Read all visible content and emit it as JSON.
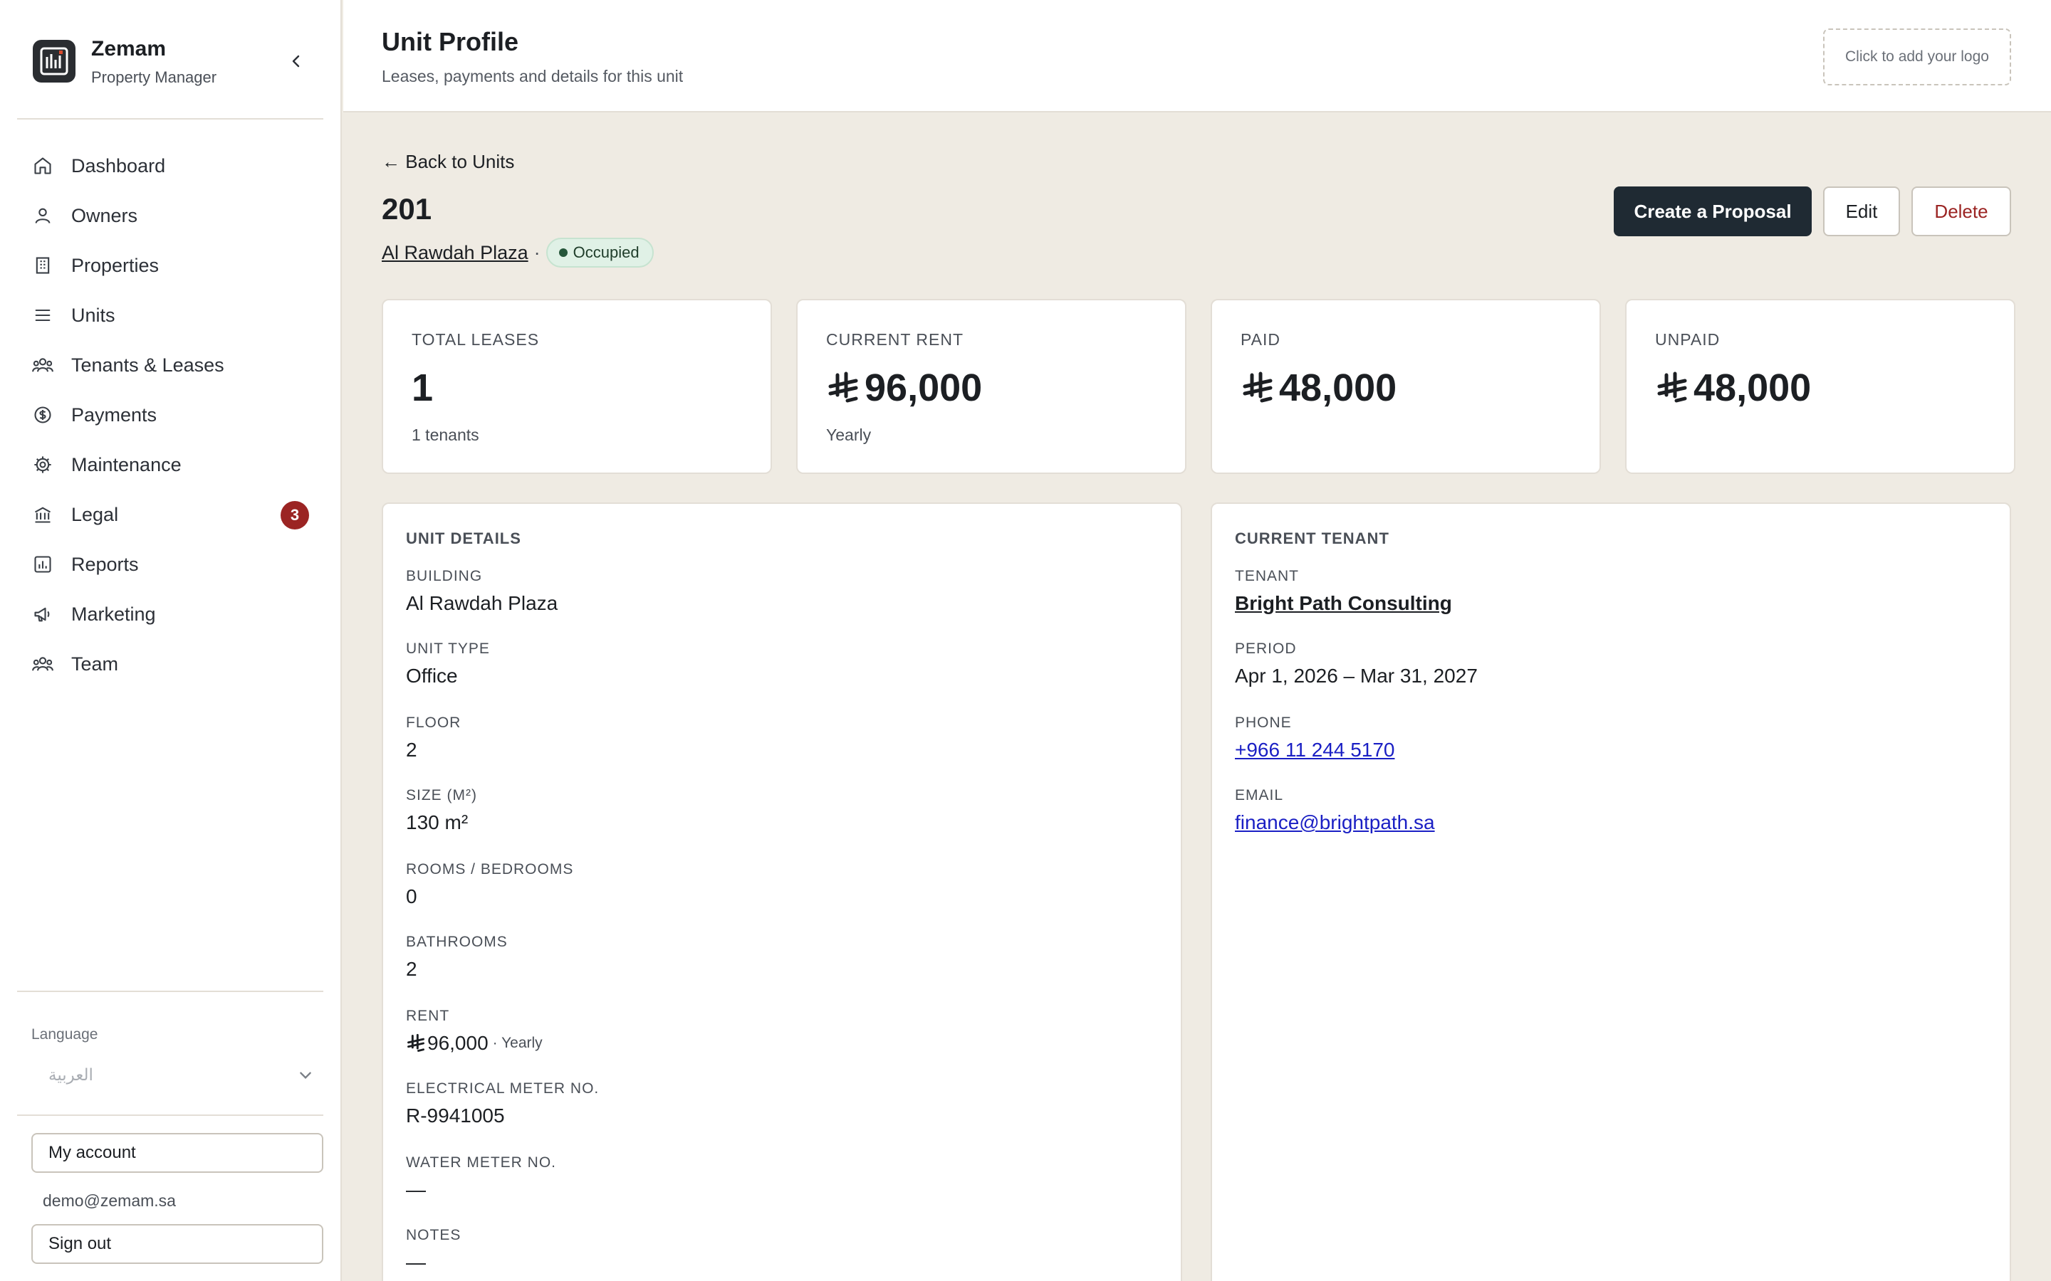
{
  "sidebar": {
    "brand_name": "Zemam",
    "brand_sub": "Property Manager",
    "nav": [
      {
        "label": "Dashboard"
      },
      {
        "label": "Owners"
      },
      {
        "label": "Properties"
      },
      {
        "label": "Units"
      },
      {
        "label": "Tenants & Leases"
      },
      {
        "label": "Payments"
      },
      {
        "label": "Maintenance"
      },
      {
        "label": "Legal",
        "badge": "3"
      },
      {
        "label": "Reports"
      },
      {
        "label": "Marketing"
      },
      {
        "label": "Team"
      }
    ],
    "language_label": "Language",
    "language_value": "العربية",
    "my_account": "My account",
    "email": "demo@zemam.sa",
    "sign_out": "Sign out"
  },
  "header": {
    "title": "Unit Profile",
    "subtitle": "Leases, payments and details for this unit",
    "logo_placeholder": "Click to add your logo"
  },
  "unit": {
    "back": "← Back to Units",
    "number": "201",
    "building": "Al Rawdah Plaza",
    "separator": "·",
    "status": "Occupied"
  },
  "actions": {
    "create": "Create a Proposal",
    "edit": "Edit",
    "delete": "Delete"
  },
  "stats": [
    {
      "label": "TOTAL LEASES",
      "value": "1",
      "foot": "1 tenants"
    },
    {
      "label": "CURRENT RENT",
      "value": "96,000",
      "foot": "Yearly"
    },
    {
      "label": "PAID",
      "value": "48,000",
      "foot": ""
    },
    {
      "label": "UNPAID",
      "value": "48,000",
      "foot": ""
    }
  ],
  "details": {
    "title": "UNIT DETAILS",
    "building_label": "BUILDING",
    "building": "Al Rawdah Plaza",
    "type_label": "UNIT TYPE",
    "type": "Office",
    "floor_label": "FLOOR",
    "floor": "2",
    "size_label": "SIZE (M²)",
    "size": "130 m²",
    "rooms_label": "ROOMS / BEDROOMS",
    "rooms": "0",
    "baths_label": "BATHROOMS",
    "baths": "2",
    "rent_label": "RENT",
    "rent": "96,000",
    "rent_period": "· Yearly",
    "elec_label": "ELECTRICAL METER NO.",
    "elec": "R-9941005",
    "water_label": "WATER METER NO.",
    "water": "—",
    "notes_label": "NOTES",
    "notes": "—"
  },
  "tenant": {
    "title": "CURRENT TENANT",
    "tenant_label": "TENANT",
    "tenant": "Bright Path Consulting",
    "period_label": "PERIOD",
    "period": "Apr 1, 2026 – Mar 31, 2027",
    "phone_label": "PHONE",
    "phone": "+966 11 244 5170",
    "email_label": "EMAIL",
    "email": "finance@brightpath.sa"
  },
  "colors": {
    "primary": "#1f2a33",
    "danger": "#9b2423",
    "link": "#1a1fc4",
    "status_bg": "#e0f1e6",
    "background": "#efebe3"
  }
}
